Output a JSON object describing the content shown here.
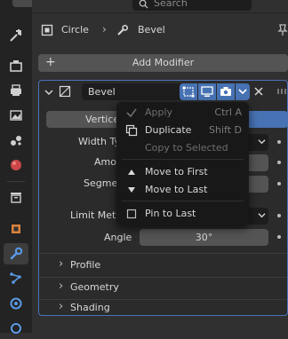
{
  "colors": {
    "accent": "#4772b3",
    "panel_border": "#4a72b8",
    "menu_bg": "#181818",
    "field": "#545454",
    "dark_field": "#1d1d1d"
  },
  "topbar": {
    "search_placeholder": "Search"
  },
  "breadcrumb": {
    "object": "Circle",
    "modifier": "Bevel"
  },
  "panel": {
    "add_modifier_label": "Add Modifier",
    "modifier_name": "Bevel",
    "tab_vertices_partial": "Vertice",
    "labels": {
      "width_type": "Width Ty",
      "amount": "Amou",
      "segments": "Segme",
      "limit_method": "Limit Meth",
      "angle": "Angle"
    },
    "angle_value": "30°",
    "subpanels": [
      "Profile",
      "Geometry",
      "Shading"
    ]
  },
  "menu": {
    "items": [
      {
        "label": "Apply",
        "shortcut": "Ctrl A",
        "disabled": true,
        "icon": "check-icon"
      },
      {
        "label": "Duplicate",
        "shortcut": "Shift D",
        "disabled": false,
        "icon": "duplicate-icon"
      },
      {
        "label": "Copy to Selected",
        "shortcut": "",
        "disabled": true,
        "icon": ""
      },
      {
        "label": "Move to First",
        "shortcut": "",
        "disabled": false,
        "icon": "triangle-up-icon"
      },
      {
        "label": "Move to Last",
        "shortcut": "",
        "disabled": false,
        "icon": "triangle-down-icon"
      },
      {
        "label": "Pin to Last",
        "shortcut": "",
        "disabled": false,
        "icon": "checkbox-icon"
      }
    ]
  }
}
